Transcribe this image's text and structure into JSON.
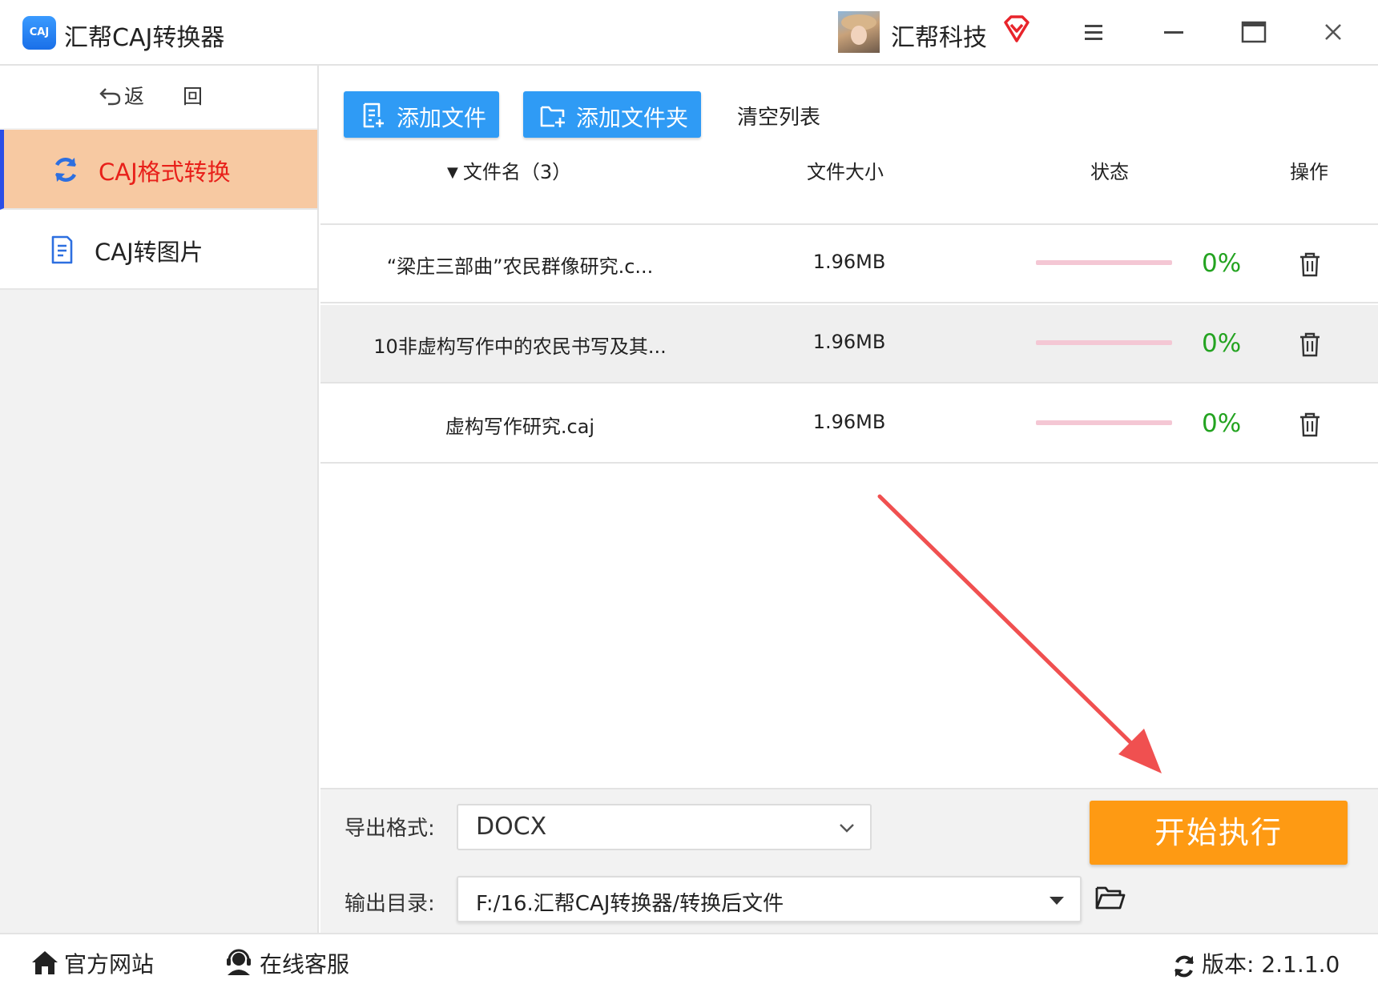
{
  "app": {
    "logo_text": "CAJ",
    "title": "汇帮CAJ转换器",
    "user_name": "汇帮科技"
  },
  "sidebar": {
    "back_label": "返 回",
    "items": [
      {
        "label": "CAJ格式转换",
        "icon": "refresh-icon",
        "active": true
      },
      {
        "label": "CAJ转图片",
        "icon": "document-icon",
        "active": false
      }
    ]
  },
  "toolbar": {
    "add_file_label": "添加文件",
    "add_folder_label": "添加文件夹",
    "clear_label": "清空列表"
  },
  "table": {
    "headers": {
      "name": "文件名（3）",
      "size": "文件大小",
      "status": "状态",
      "action": "操作"
    },
    "rows": [
      {
        "name": "“梁庄三部曲”农民群像研究.c...",
        "size": "1.96MB",
        "progress": 0,
        "percent": "0%"
      },
      {
        "name": "10非虚构写作中的农民书写及其...",
        "size": "1.96MB",
        "progress": 0,
        "percent": "0%"
      },
      {
        "name": "虚构写作研究.caj",
        "size": "1.96MB",
        "progress": 0,
        "percent": "0%"
      }
    ]
  },
  "settings": {
    "format_label": "导出格式:",
    "format_value": "DOCX",
    "dir_label": "输出目录:",
    "dir_value": "F:/16.汇帮CAJ转换器/转换后文件",
    "start_label": "开始执行"
  },
  "footer": {
    "site_label": "官方网站",
    "service_label": "在线客服",
    "version_label": "版本: 2.1.1.0"
  },
  "colors": {
    "accent_blue": "#2f9bf5",
    "active_nav_bg": "#f7c9a2",
    "active_nav_text": "#e8201a",
    "start_button": "#fe9a13",
    "percent_green": "#23a320",
    "annotation_arrow": "#f05050"
  }
}
